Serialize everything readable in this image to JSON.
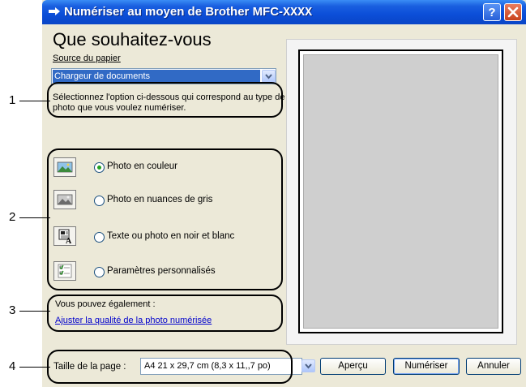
{
  "window": {
    "title": "Numériser au moyen de Brother MFC-",
    "title_model": "XXXX",
    "help_label": "?"
  },
  "main": {
    "heading": "Que souhaitez-vous",
    "paper_source_label": "Source du papier",
    "paper_source_value": "Chargeur de documents",
    "instructions": "Sélectionnez l'option ci-dessous qui correspond au type de photo que vous voulez numériser.",
    "options": [
      {
        "label": "Photo en couleur",
        "selected": true,
        "icon": "color-photo-icon"
      },
      {
        "label": "Photo en nuances de gris",
        "selected": false,
        "icon": "grayscale-photo-icon"
      },
      {
        "label": "Texte ou photo en noir et blanc",
        "selected": false,
        "icon": "black-white-text-icon"
      },
      {
        "label": "Paramètres personnalisés",
        "selected": false,
        "icon": "custom-settings-icon"
      }
    ],
    "also_text": "Vous pouvez également :",
    "adjust_link": "Ajuster la qualité de la photo numérisée",
    "page_size_label": "Taille de la page :",
    "page_size_value": "A4 21 x 29,7 cm (8,3 x 11,,7 po)"
  },
  "buttons": {
    "preview": "Aperçu",
    "scan": "Numériser",
    "cancel": "Annuler"
  },
  "callouts": [
    "1",
    "2",
    "3",
    "4"
  ],
  "colors": {
    "titlebar": "#0b4ed8",
    "selection": "#316ac5",
    "dialog_bg": "#ece9d8",
    "link": "#0000cc"
  }
}
